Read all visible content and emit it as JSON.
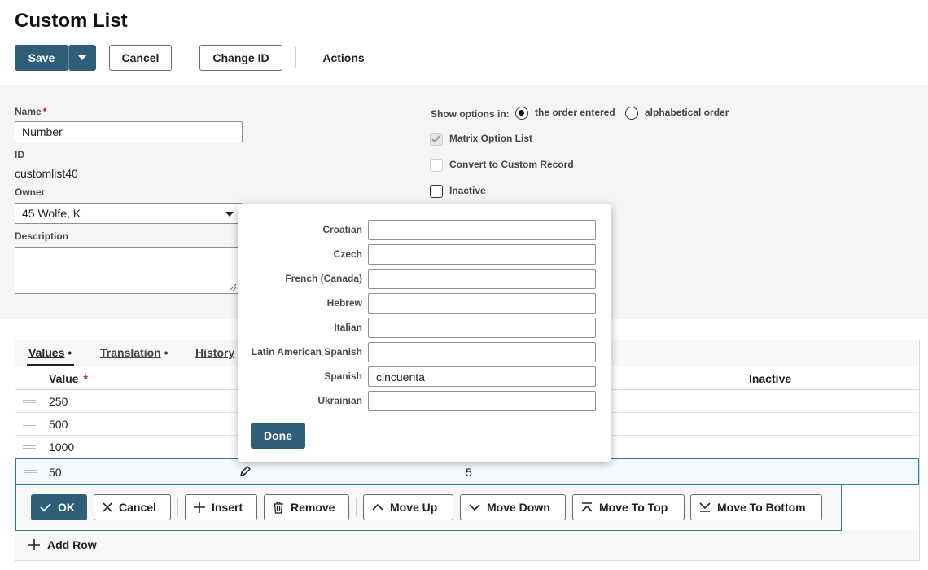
{
  "page_title": "Custom List",
  "toolbar": {
    "save": "Save",
    "cancel": "Cancel",
    "change_id": "Change ID",
    "actions": "Actions"
  },
  "form": {
    "name_label": "Name",
    "required_mark": "*",
    "name_value": "Number",
    "id_label": "ID",
    "id_value": "customlist40",
    "owner_label": "Owner",
    "owner_value": "45 Wolfe, K",
    "description_label": "Description",
    "description_value": "",
    "show_options_label": "Show options in:",
    "option_order_entered": "the order entered",
    "option_alphabetical": "alphabetical order",
    "selected_option": "the order entered",
    "matrix_label": "Matrix Option List",
    "matrix_checked": true,
    "convert_label": "Convert to Custom Record",
    "convert_checked": false,
    "inactive_label": "Inactive",
    "inactive_checked": false
  },
  "tabs": [
    {
      "label": "Values",
      "suffix": " •"
    },
    {
      "label": "Translation",
      "suffix": " •"
    },
    {
      "label": "History",
      "suffix": ""
    }
  ],
  "table": {
    "headers": {
      "value": "Value",
      "value_required": "*",
      "inactive": "Inactive"
    },
    "rows": [
      {
        "value": "250"
      },
      {
        "value": "500"
      },
      {
        "value": "1000"
      }
    ],
    "edit_row": {
      "value": "50",
      "order": "5"
    },
    "add_row": "Add Row"
  },
  "row_toolbar": {
    "ok": "OK",
    "cancel": "Cancel",
    "insert": "Insert",
    "remove": "Remove",
    "move_up": "Move Up",
    "move_down": "Move Down",
    "move_to_top": "Move To Top",
    "move_to_bottom": "Move To Bottom"
  },
  "translation_popup": {
    "fields": [
      {
        "label": "Croatian",
        "value": ""
      },
      {
        "label": "Czech",
        "value": ""
      },
      {
        "label": "French (Canada)",
        "value": ""
      },
      {
        "label": "Hebrew",
        "value": ""
      },
      {
        "label": "Italian",
        "value": ""
      },
      {
        "label": "Latin American Spanish",
        "value": ""
      },
      {
        "label": "Spanish",
        "value": "cincuenta"
      },
      {
        "label": "Ukrainian",
        "value": ""
      }
    ],
    "done": "Done"
  },
  "colors": {
    "primary": "#2f5e79",
    "edit_border": "#2f7c94",
    "required": "#b3261e"
  }
}
